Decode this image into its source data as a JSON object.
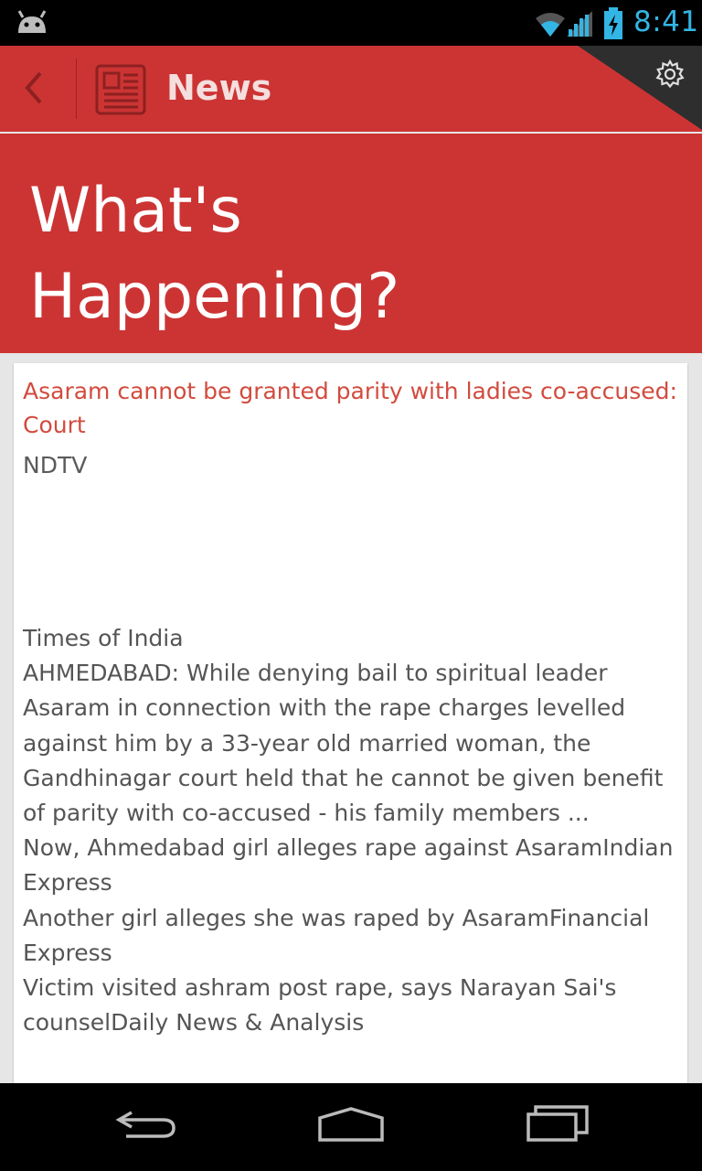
{
  "status_bar": {
    "time": "8:41",
    "icons": [
      "android-debug-icon",
      "wifi-icon",
      "signal-icon",
      "battery-charging-icon"
    ]
  },
  "action_bar": {
    "title": "News",
    "icons": [
      "back-icon",
      "newspaper-icon",
      "settings-gear-icon"
    ]
  },
  "hero": {
    "title": "What's\nHappening?"
  },
  "article": {
    "headline": "Asaram cannot be granted parity with ladies co-accused: Court",
    "source": "NDTV",
    "body_lines": [
      "Times of India",
      "AHMEDABAD: While denying bail to spiritual leader Asaram in connection with the rape charges levelled against him by a 33-year old married woman, the Gandhinagar court held that he cannot be given benefit of parity with co-accused - his family members ...",
      "Now, Ahmedabad girl alleges rape against AsaramIndian Express",
      "Another girl alleges she was raped by AsaramFinancial Express",
      "Victim visited ashram post rape, says Narayan Sai's counselDaily News & Analysis"
    ]
  },
  "nav_bar": {
    "icons": [
      "back-nav-icon",
      "home-nav-icon",
      "recent-apps-icon"
    ]
  },
  "colors": {
    "accent_red": "#cc3434",
    "headline_red": "#d24b3e",
    "status_blue": "#33b5e5"
  }
}
